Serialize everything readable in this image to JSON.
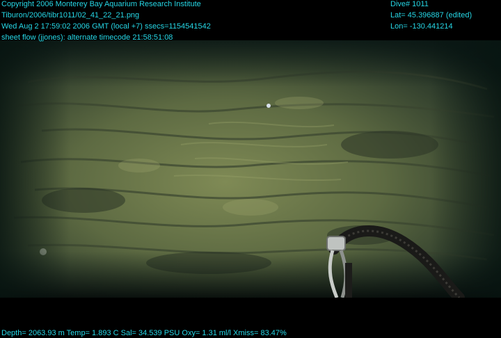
{
  "overlay": {
    "top_left": [
      "Copyright 2006 Monterey Bay Aquarium Research Institute",
      "Tiburon/2006/tibr1011/02_41_22_21.png",
      "Wed Aug  2 17:59:02 2006 GMT (local +7)  ssecs=1154541542",
      "sheet flow (jjones): alternate timecode 21:58:51:08"
    ],
    "top_right": [
      "Dive# 1011",
      "Lat= 45.396887 (edited)",
      "Lon= -130.441214"
    ],
    "bottom": "Depth= 2063.93 m  Temp= 1.893 C  Sal= 34.539 PSU  Oxy= 1.31 ml/l  Xmiss= 83.47%"
  },
  "colors": {
    "overlay_text": "#26d7e6",
    "water_dark": "#0c1a16",
    "sediment": "#6e7a48",
    "rock": "#4f5a3a"
  }
}
